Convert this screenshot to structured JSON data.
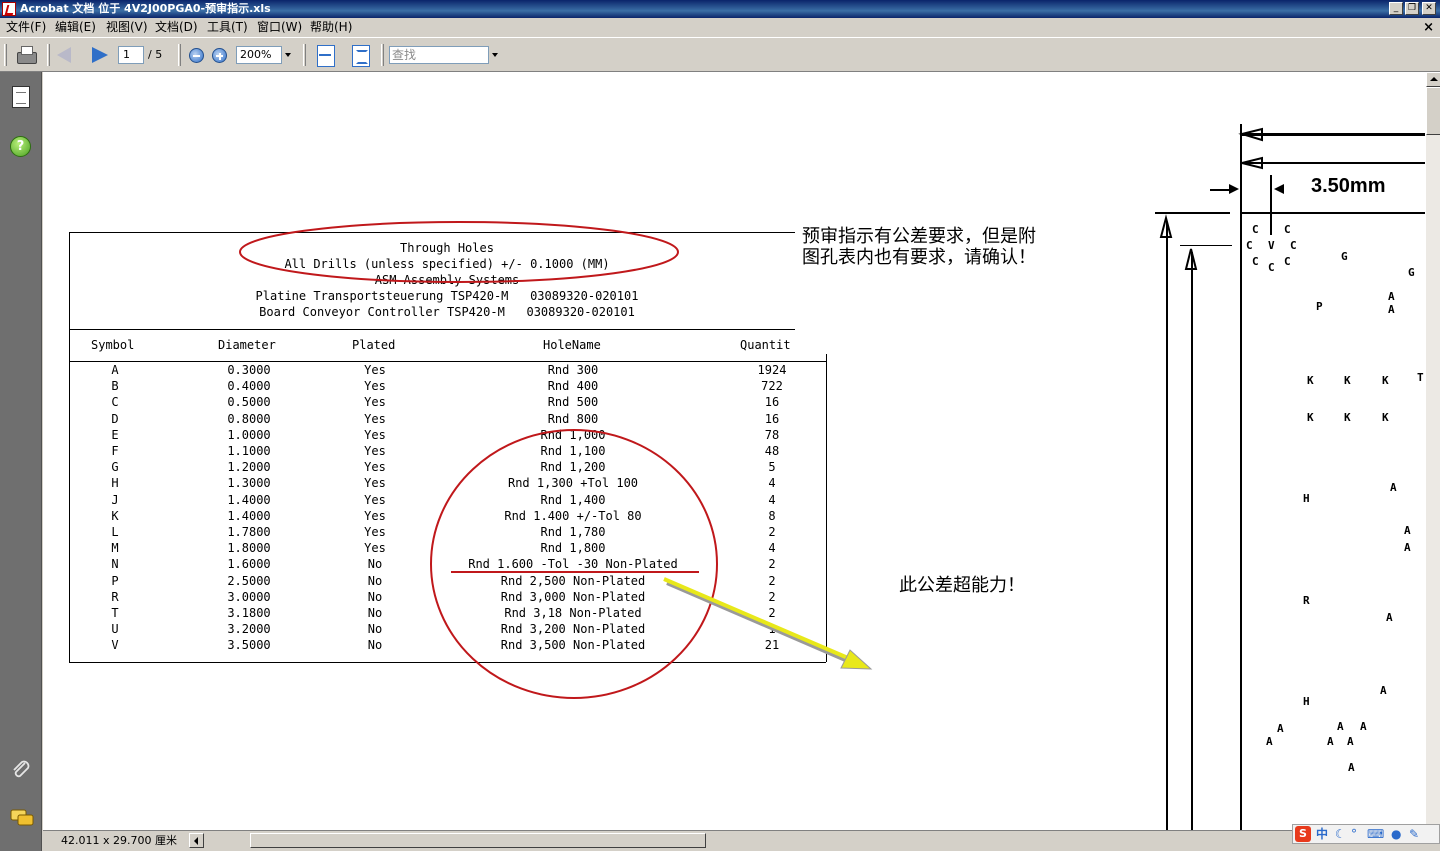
{
  "window": {
    "title": "Acrobat 文档 位于 4V2J00PGA0-预审指示.xls",
    "buttons": [
      "_",
      "❐",
      "✕"
    ]
  },
  "menu": {
    "items": [
      "文件(F)",
      "编辑(E)",
      "视图(V)",
      "文档(D)",
      "工具(T)",
      "窗口(W)",
      "帮助(H)"
    ],
    "close": "×"
  },
  "toolbar": {
    "page_current": "1",
    "page_total": "/ 5",
    "zoom": "200%",
    "search_placeholder": "查找"
  },
  "status": {
    "page_size": "42.011 x 29.700 厘米"
  },
  "ime": {
    "lang": "中",
    "icons": [
      "sogou-icon",
      "moon-icon",
      "punct-icon",
      "keyboard-icon",
      "user-icon",
      "wrench-icon"
    ]
  },
  "drill_table": {
    "header_lines": [
      "Through Holes",
      "All Drills (unless specified) +/- 0.1000 (MM)",
      "ASM Assembly Systems",
      "Platine Transportsteuerung TSP420-M   03089320-020101",
      "Board Conveyor Controller TSP420-M   03089320-020101"
    ],
    "columns": [
      "Symbol",
      "Diameter",
      "Plated",
      "HoleName",
      "Quantit"
    ],
    "rows": [
      [
        "A",
        "0.3000",
        "Yes",
        "Rnd 300",
        "1924"
      ],
      [
        "B",
        "0.4000",
        "Yes",
        "Rnd 400",
        "722"
      ],
      [
        "C",
        "0.5000",
        "Yes",
        "Rnd 500",
        "16"
      ],
      [
        "D",
        "0.8000",
        "Yes",
        "Rnd 800",
        "16"
      ],
      [
        "E",
        "1.0000",
        "Yes",
        "Rnd 1,000",
        "78"
      ],
      [
        "F",
        "1.1000",
        "Yes",
        "Rnd 1,100",
        "48"
      ],
      [
        "G",
        "1.2000",
        "Yes",
        "Rnd 1,200",
        "5"
      ],
      [
        "H",
        "1.3000",
        "Yes",
        "Rnd 1,300 +Tol 100",
        "4"
      ],
      [
        "J",
        "1.4000",
        "Yes",
        "Rnd 1,400",
        "4"
      ],
      [
        "K",
        "1.4000",
        "Yes",
        "Rnd 1.400 +/-Tol 80",
        "8"
      ],
      [
        "L",
        "1.7800",
        "Yes",
        "Rnd 1,780",
        "2"
      ],
      [
        "M",
        "1.8000",
        "Yes",
        "Rnd 1,800",
        "4"
      ],
      [
        "N",
        "1.6000",
        "No",
        "Rnd 1.600 -Tol -30 Non-Plated",
        "2"
      ],
      [
        "P",
        "2.5000",
        "No",
        "Rnd 2,500 Non-Plated",
        "2"
      ],
      [
        "R",
        "3.0000",
        "No",
        "Rnd 3,000 Non-Plated",
        "2"
      ],
      [
        "T",
        "3.1800",
        "No",
        "Rnd 3,18 Non-Plated",
        "2"
      ],
      [
        "U",
        "3.2000",
        "No",
        "Rnd 3,200 Non-Plated",
        "1"
      ],
      [
        "V",
        "3.5000",
        "No",
        "Rnd 3,500 Non-Plated",
        "21"
      ]
    ]
  },
  "annotations": {
    "note1_line1": "预审指示有公差要求，但是附",
    "note1_line2": "图孔表内也有要求，请确认！",
    "note2": "此公差超能力！",
    "ellipse_color": "#c0181b",
    "arrow_color": "#e8e81a"
  },
  "drawing": {
    "dimension": "3.50mm",
    "letters": [
      "C",
      "C",
      "C",
      "V",
      "C",
      "C",
      "C",
      "C",
      "G",
      "G",
      "P",
      "A",
      "A",
      "K",
      "K",
      "K",
      "T",
      "K",
      "K",
      "K",
      "A",
      "H",
      "A",
      "A",
      "R",
      "A",
      "A",
      "H",
      "A",
      "A",
      "A",
      "A",
      "A",
      "A",
      "A"
    ]
  }
}
